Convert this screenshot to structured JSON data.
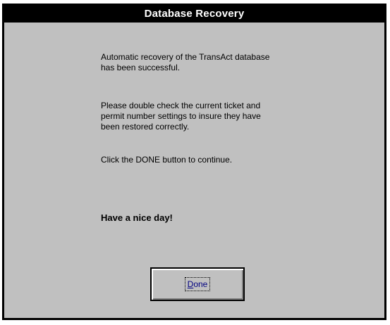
{
  "dialog": {
    "title": "Database Recovery",
    "paragraphs": [
      "Automatic recovery of the TransAct database\nhas been successful.",
      "Please double check the current ticket and\npermit number settings to insure they have\nbeen restored correctly.",
      "Click the DONE button to continue.",
      "Have a nice day!"
    ],
    "done_button": {
      "accel_letter": "D",
      "rest_label": "one"
    }
  },
  "colors": {
    "titlebar_bg": "#000000",
    "dialog_bg": "#c0c0c0",
    "button_text": "#000080"
  }
}
